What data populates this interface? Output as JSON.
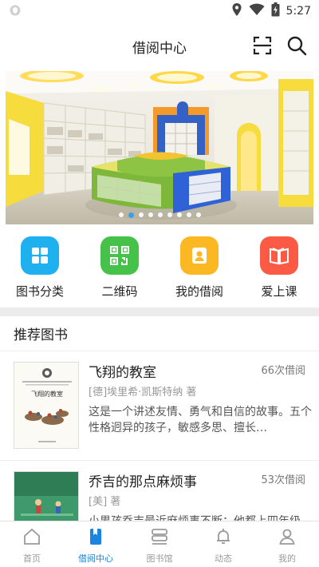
{
  "status_bar": {
    "time": "5:27",
    "icons": [
      "shield-icon",
      "location-icon",
      "wifi-icon",
      "battery-icon"
    ]
  },
  "header": {
    "title": "借阅中心",
    "actions": [
      "scan-icon",
      "search-icon"
    ]
  },
  "banner": {
    "slide_count": 9,
    "active_index": 1,
    "image": "library-interior-photo"
  },
  "quick_menu": [
    {
      "label": "图书分类",
      "icon": "grid-icon",
      "color": "#1fb0f0"
    },
    {
      "label": "二维码",
      "icon": "qrcode-icon",
      "color": "#46c24b"
    },
    {
      "label": "我的借阅",
      "icon": "user-icon",
      "color": "#fcb823"
    },
    {
      "label": "爱上课",
      "icon": "open-book-icon",
      "color": "#fb5a45"
    }
  ],
  "section": {
    "title": "推荐图书"
  },
  "books": [
    {
      "title": "飞翔的教室",
      "count": "66次借阅",
      "author": "[德]埃里希·凯斯特纳 著",
      "desc": "这是一个讲述友情、勇气和自信的故事。五个性格迥异的孩子，敏感多思、擅长…",
      "cover_text": "飞翔的教室"
    },
    {
      "title": "乔吉的那点麻烦事",
      "count": "53次借阅",
      "author": "[美] 著",
      "desc": "小男孩乔吉最近麻烦事不断：他都上四年级了…",
      "cover_text": ""
    }
  ],
  "tab_bar": {
    "items": [
      {
        "label": "首页",
        "icon": "home-icon"
      },
      {
        "label": "借阅中心",
        "icon": "bookmark-book-icon"
      },
      {
        "label": "图书馆",
        "icon": "library-icon"
      },
      {
        "label": "动态",
        "icon": "bell-icon"
      },
      {
        "label": "我的",
        "icon": "person-icon"
      }
    ],
    "active_index": 1,
    "active_color": "#1a84e0",
    "inactive_color": "#9a9a9a"
  }
}
